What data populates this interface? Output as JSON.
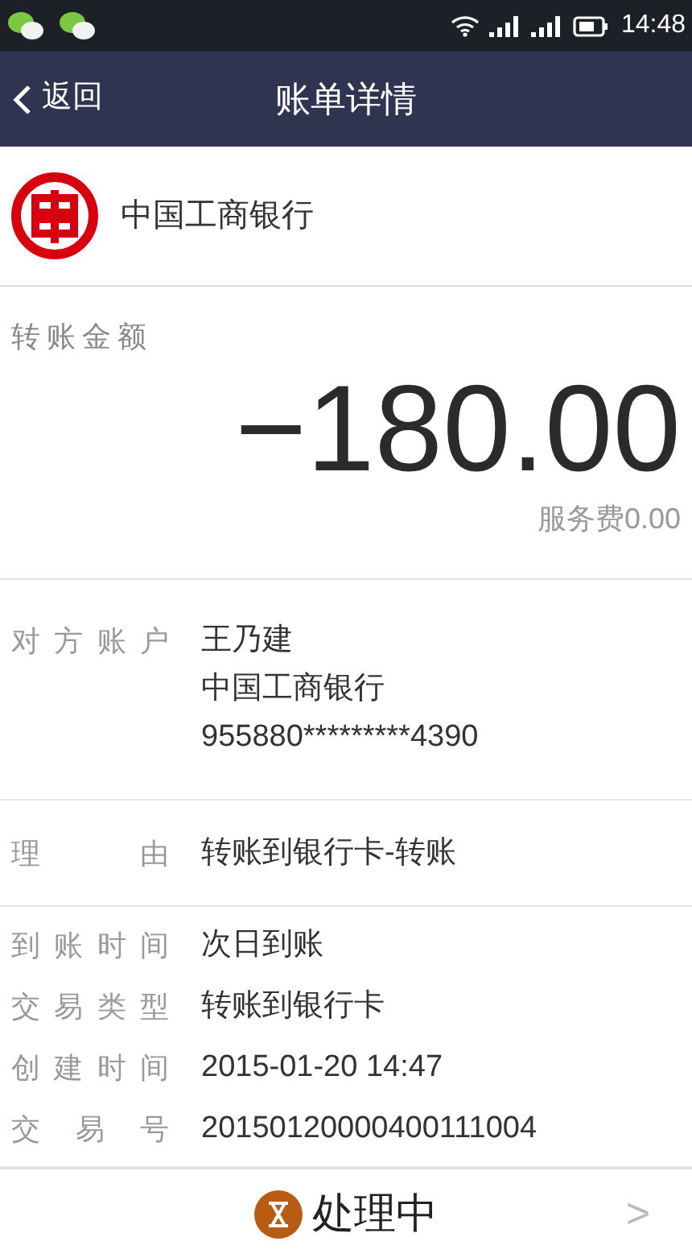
{
  "status_bar": {
    "time": "14:48"
  },
  "nav": {
    "back": "返回",
    "title": "账单详情"
  },
  "bank": {
    "name": "中国工商银行"
  },
  "amount": {
    "label": "转账金额",
    "value": "−180.00",
    "fee": "服务费0.00"
  },
  "sections": [
    {
      "rows": [
        {
          "label": "对方账户",
          "values": [
            "王乃建",
            "中国工商银行",
            "955880*********4390"
          ]
        }
      ]
    },
    {
      "rows": [
        {
          "label": "理由",
          "values": [
            "转账到银行卡-转账"
          ]
        }
      ]
    },
    {
      "rows": [
        {
          "label": "到账时间",
          "values": [
            "次日到账"
          ]
        },
        {
          "label": "交易类型",
          "values": [
            "转账到银行卡"
          ]
        },
        {
          "label": "创建时间",
          "values": [
            "2015-01-20 14:47"
          ]
        },
        {
          "label": "交易号",
          "values": [
            "20150120000400111004"
          ]
        }
      ]
    }
  ],
  "footer": {
    "status": "处理中",
    "arrow": ">"
  }
}
